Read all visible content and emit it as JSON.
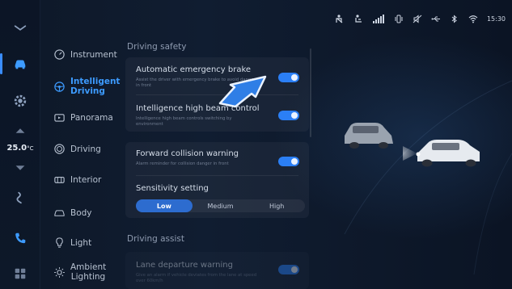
{
  "status": {
    "time": "15:30",
    "icons": [
      "seatbelt-icon",
      "seat-icon",
      "signal-icon",
      "vibrate-icon",
      "mute-icon",
      "usb-icon",
      "bluetooth-icon",
      "wifi-icon"
    ]
  },
  "rail": {
    "items": [
      "collapse-chevron-icon",
      "car-icon",
      "settings-icon",
      "temperature-up-icon",
      "temperature-down-icon",
      "seat-heat-icon",
      "phone-icon",
      "apps-icon"
    ],
    "temperature_value": "25.0",
    "temperature_unit": "°C"
  },
  "menu": {
    "items": [
      {
        "label": "Instrument",
        "icon": "gauge-icon"
      },
      {
        "label": "Intelligent Driving",
        "icon": "steering-wheel-icon",
        "active": true
      },
      {
        "label": "Panorama",
        "icon": "camera-icon"
      },
      {
        "label": "Driving",
        "icon": "driving-mode-icon"
      },
      {
        "label": "Interior",
        "icon": "interior-icon"
      },
      {
        "label": "Body",
        "icon": "car-body-icon"
      },
      {
        "label": "Light",
        "icon": "light-bulb-icon"
      },
      {
        "label": "Ambient Lighting",
        "icon": "ambient-light-icon"
      }
    ]
  },
  "panel": {
    "section_safety": "Driving safety",
    "aeb_title": "Automatic emergency brake",
    "aeb_desc": "Assist the driver with emergency brake to avoid danger in front",
    "aeb_on": true,
    "ihbc_title": "Intelligence high beam control",
    "ihbc_desc": "Intelligence high beam controls switching by environment",
    "ihbc_on": true,
    "fcw_title": "Forward collision warning",
    "fcw_desc": "Alarm reminder for collision danger in front",
    "fcw_on": true,
    "sensitivity_title": "Sensitivity setting",
    "sensitivity_options": [
      "Low",
      "Medium",
      "High"
    ],
    "sensitivity_selected": "Low",
    "section_assist": "Driving assist",
    "ldw_title": "Lane departure warning",
    "ldw_desc": "Give an alarm if vehicle deviates from the lane at speed over 60km/h",
    "ldw_on": true
  },
  "colors": {
    "accent": "#3d9bff",
    "toggle_on": "#2b7ff5",
    "background": "#0e1828"
  }
}
